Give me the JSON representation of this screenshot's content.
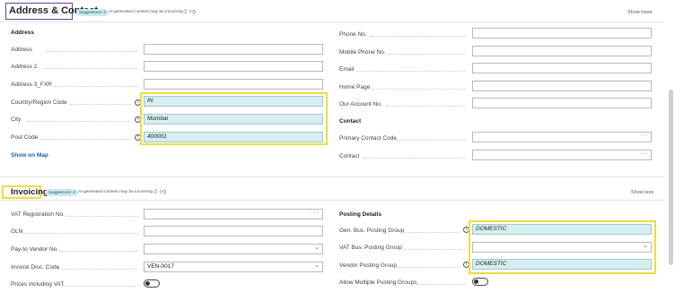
{
  "address_section": {
    "title": "Address & Contact",
    "suggestions": "Suggestions: 3",
    "ai_note": "AI-generated content may be incorrect",
    "show_more": "Show more",
    "group_title": "Address",
    "left_fields": [
      {
        "label": "Address",
        "value": ""
      },
      {
        "label": "Address 2",
        "value": ""
      },
      {
        "label": "Address 3_FXR",
        "value": ""
      },
      {
        "label": "Country/Region Code",
        "value": "IN"
      },
      {
        "label": "City",
        "value": "Mumbai"
      },
      {
        "label": "Post Code",
        "value": "400001"
      }
    ],
    "show_on_map": "Show on Map",
    "right_fields": [
      {
        "label": "Phone No.",
        "value": ""
      },
      {
        "label": "Mobile Phone No.",
        "value": ""
      },
      {
        "label": "Email",
        "value": ""
      },
      {
        "label": "Home Page",
        "value": ""
      },
      {
        "label": "Our Account No.",
        "value": ""
      }
    ],
    "contact_title": "Contact",
    "contact_fields": [
      {
        "label": "Primary Contact Code",
        "value": ""
      },
      {
        "label": "Contact",
        "value": ""
      }
    ]
  },
  "invoicing_section": {
    "title": "Invoicing",
    "suggestions": "Suggestions: 2",
    "ai_note": "AI-generated content may be incorrect",
    "show_less": "Show less",
    "left_fields": [
      {
        "label": "VAT Registration No.",
        "value": ""
      },
      {
        "label": "GLN",
        "value": ""
      },
      {
        "label": "Pay-to Vendor No.",
        "value": ""
      },
      {
        "label": "Invoice Disc. Code",
        "value": "VEN-0017"
      },
      {
        "label": "Prices Including VAT",
        "value": ""
      }
    ],
    "posting_title": "Posting Details",
    "right_fields": [
      {
        "label": "Gen. Bus. Posting Group",
        "value": "DOMESTIC"
      },
      {
        "label": "VAT Bus. Posting Group",
        "value": ""
      },
      {
        "label": "Vendor Posting Group",
        "value": "DOMESTIC"
      },
      {
        "label": "Allow Multiple Posting Groups",
        "value": ""
      }
    ]
  },
  "icons": {
    "thumbs_up": "thumbs-up-icon",
    "thumbs_down": "thumbs-down-icon",
    "info": "info-icon",
    "chevron": "chevron-down-icon",
    "ellipsis": "ellipsis-icon"
  },
  "colors": {
    "ai_fill": "#d7eef0",
    "highlight_yellow": "#f0dc3a",
    "highlight_purple": "#6a3fa0",
    "link": "#1a5fa8"
  }
}
